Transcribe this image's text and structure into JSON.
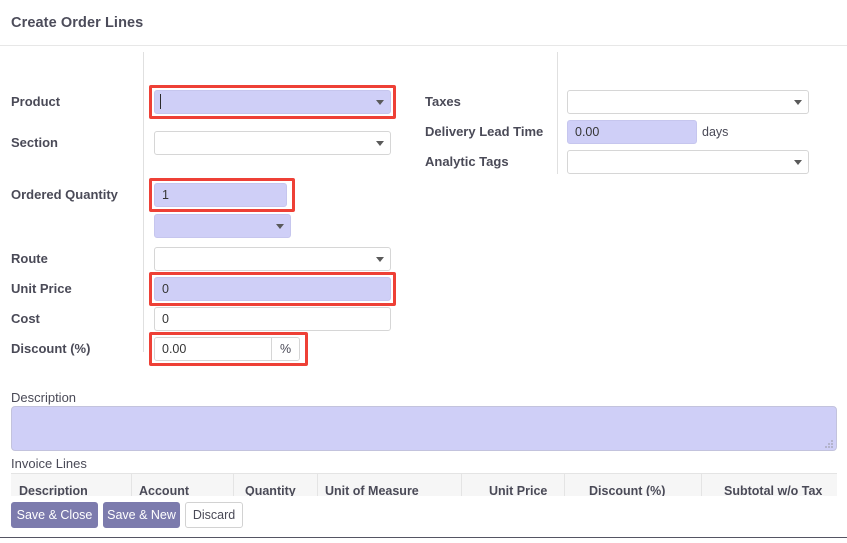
{
  "dialog": {
    "title": "Create Order Lines"
  },
  "form": {
    "left_fields": [
      {
        "label": "Product",
        "value": "",
        "kind": "dropdown",
        "filled": true,
        "highlighted": true
      },
      {
        "label": "Section",
        "value": "",
        "kind": "dropdown",
        "filled": false,
        "highlighted": false
      },
      {
        "label": "Ordered Quantity",
        "value": "1",
        "kind": "text",
        "filled": true,
        "highlighted": true
      },
      {
        "label": "",
        "value": "",
        "kind": "dropdown",
        "filled": true,
        "highlighted": false
      },
      {
        "label": "Route",
        "value": "",
        "kind": "dropdown",
        "filled": false,
        "highlighted": false
      },
      {
        "label": "Unit Price",
        "value": "0",
        "kind": "text",
        "filled": true,
        "highlighted": true
      },
      {
        "label": "Cost",
        "value": "0",
        "kind": "text",
        "filled": false,
        "highlighted": false
      },
      {
        "label": "Discount (%)",
        "value": "0.00",
        "kind": "text",
        "filled": false,
        "highlighted": true,
        "suffix": "%"
      }
    ],
    "right_fields": [
      {
        "label": "Taxes",
        "value": "",
        "kind": "dropdown",
        "filled": false,
        "highlighted": false
      },
      {
        "label": "Delivery Lead Time",
        "value": "0.00",
        "kind": "text",
        "filled": true,
        "highlighted": false,
        "unit": "days"
      },
      {
        "label": "Analytic Tags",
        "value": "",
        "kind": "dropdown",
        "filled": false,
        "highlighted": false
      }
    ]
  },
  "description": {
    "label": "Description",
    "value": ""
  },
  "invoice_lines": {
    "label": "Invoice Lines",
    "columns": [
      "Description",
      "Account",
      "Quantity",
      "Unit of Measure",
      "Unit Price",
      "Discount (%)",
      "Subtotal w/o Tax"
    ]
  },
  "footer": {
    "buttons": [
      {
        "label": "Save & Close",
        "style": "primary"
      },
      {
        "label": "Save & New",
        "style": "primary"
      },
      {
        "label": "Discard",
        "style": "default"
      }
    ]
  },
  "colors": {
    "accent": "#7c7bad",
    "highlight": "#ee4036",
    "field_fill": "#cfcff7"
  },
  "icons": {
    "caret": "chevron-down-icon",
    "resize": "resize-grip-icon"
  }
}
